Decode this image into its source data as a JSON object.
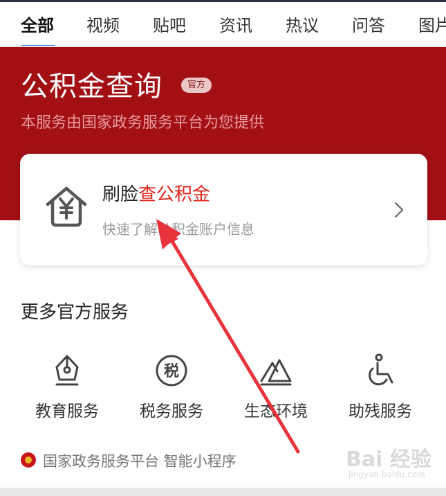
{
  "tabs": [
    {
      "label": "全部",
      "active": true
    },
    {
      "label": "视频"
    },
    {
      "label": "贴吧"
    },
    {
      "label": "资讯"
    },
    {
      "label": "热议"
    },
    {
      "label": "问答"
    },
    {
      "label": "图片"
    }
  ],
  "hero": {
    "title": "公积金查询",
    "badge": "官方",
    "subtitle": "本服务由国家政务服务平台为您提供"
  },
  "card": {
    "title_prefix": "刷脸",
    "title_highlight": "查公积金",
    "subtitle": "快速了解公积金账户信息",
    "icon": "house-yuan-icon"
  },
  "more_services": {
    "title": "更多官方服务",
    "items": [
      {
        "label": "教育服务",
        "icon": "pen-nib-icon"
      },
      {
        "label": "税务服务",
        "icon": "tax-icon",
        "icon_text": "税"
      },
      {
        "label": "生态环境",
        "icon": "mountain-icon"
      },
      {
        "label": "助残服务",
        "icon": "wheelchair-icon"
      }
    ]
  },
  "footer": {
    "text": "国家政务服务平台  智能小程序"
  },
  "watermark": {
    "text": "Bai 经验",
    "url": "jingyan.baidu.com"
  },
  "colors": {
    "hero_red": "#a21014",
    "highlight_red": "#e1251b",
    "tab_accent": "#3b78e7",
    "arrow_red": "#e8323c"
  }
}
